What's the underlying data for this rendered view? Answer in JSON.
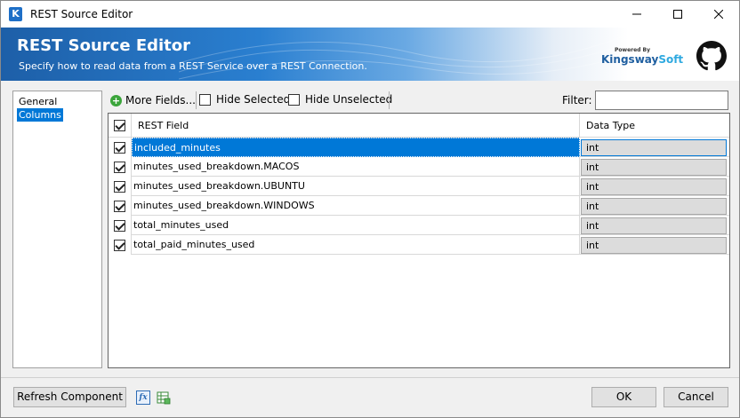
{
  "window": {
    "title": "REST Source Editor",
    "app_icon": "K"
  },
  "banner": {
    "title": "REST Source Editor",
    "subtitle": "Specify how to read data from a REST Service over a REST Connection.",
    "logo_powered": "Powered By",
    "logo_name_main": "Kingsway",
    "logo_name_suffix": "Soft"
  },
  "nav": {
    "items": [
      {
        "label": "General",
        "selected": false
      },
      {
        "label": "Columns",
        "selected": true
      }
    ]
  },
  "toolbar": {
    "more_fields_label": "More Fields...",
    "hide_selected_label": "Hide Selected",
    "hide_unselected_label": "Hide Unselected",
    "filter_label": "Filter:",
    "filter_value": ""
  },
  "grid": {
    "headers": {
      "field": "REST Field",
      "type": "Data Type"
    },
    "rows": [
      {
        "field": "included_minutes",
        "type": "int",
        "checked": true,
        "selected": true
      },
      {
        "field": "minutes_used_breakdown.MACOS",
        "type": "int",
        "checked": true,
        "selected": false
      },
      {
        "field": "minutes_used_breakdown.UBUNTU",
        "type": "int",
        "checked": true,
        "selected": false
      },
      {
        "field": "minutes_used_breakdown.WINDOWS",
        "type": "int",
        "checked": true,
        "selected": false
      },
      {
        "field": "total_minutes_used",
        "type": "int",
        "checked": true,
        "selected": false
      },
      {
        "field": "total_paid_minutes_used",
        "type": "int",
        "checked": true,
        "selected": false
      }
    ]
  },
  "footer": {
    "refresh_label": "Refresh Component",
    "fx_icon": "fx",
    "ok_label": "OK",
    "cancel_label": "Cancel"
  },
  "colors": {
    "accent": "#0078d7",
    "banner_dark": "#1d5fa8",
    "logo_blue": "#1f5fa0",
    "logo_light": "#2fa9e0"
  }
}
